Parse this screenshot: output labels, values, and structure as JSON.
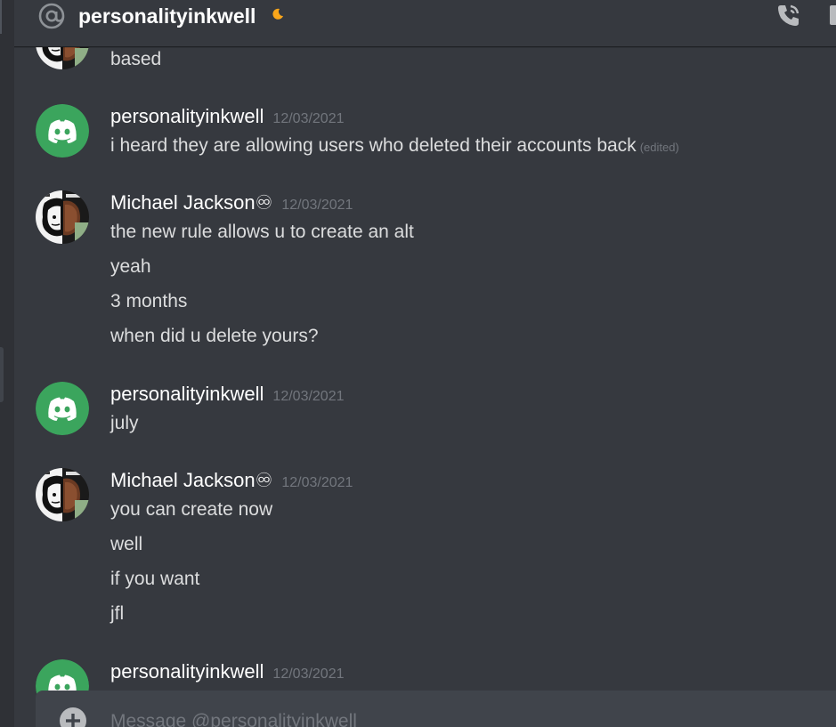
{
  "header": {
    "title": "personalityinkwell"
  },
  "messages": [
    {
      "id": "g0",
      "username": "",
      "timestamp": "",
      "lines": [
        "based"
      ]
    },
    {
      "id": "g1",
      "username": "personalityinkwell",
      "timestamp": "12/03/2021",
      "lines": [
        "i heard they are allowing users who deleted their accounts back"
      ],
      "edited_label": "(edited)"
    },
    {
      "id": "g2",
      "username": "Michael Jackson♾",
      "timestamp": "12/03/2021",
      "lines": [
        "the new rule allows u to create an alt",
        "yeah",
        "3 months",
        "when did u delete yours?"
      ]
    },
    {
      "id": "g3",
      "username": "personalityinkwell",
      "timestamp": "12/03/2021",
      "lines": [
        "july"
      ]
    },
    {
      "id": "g4",
      "username": "Michael Jackson♾",
      "timestamp": "12/03/2021",
      "lines": [
        "you can create now",
        "well",
        "if you want",
        "jfl"
      ]
    },
    {
      "id": "g5",
      "username": "personalityinkwell",
      "timestamp": "12/03/2021",
      "lines": []
    }
  ],
  "composer": {
    "placeholder": "Message @personalityinkwell"
  },
  "colors": {
    "background": "#36393f",
    "discord_green": "#3ba55d",
    "idle_moon": "#faa61a",
    "timestamp": "#72767d",
    "text": "#dcddde"
  },
  "icons": {
    "header_at": "at-icon",
    "status": "moon-icon",
    "call": "call-icon",
    "composer_add": "plus-circle-icon",
    "default_avatar": "discord-logo-icon"
  }
}
